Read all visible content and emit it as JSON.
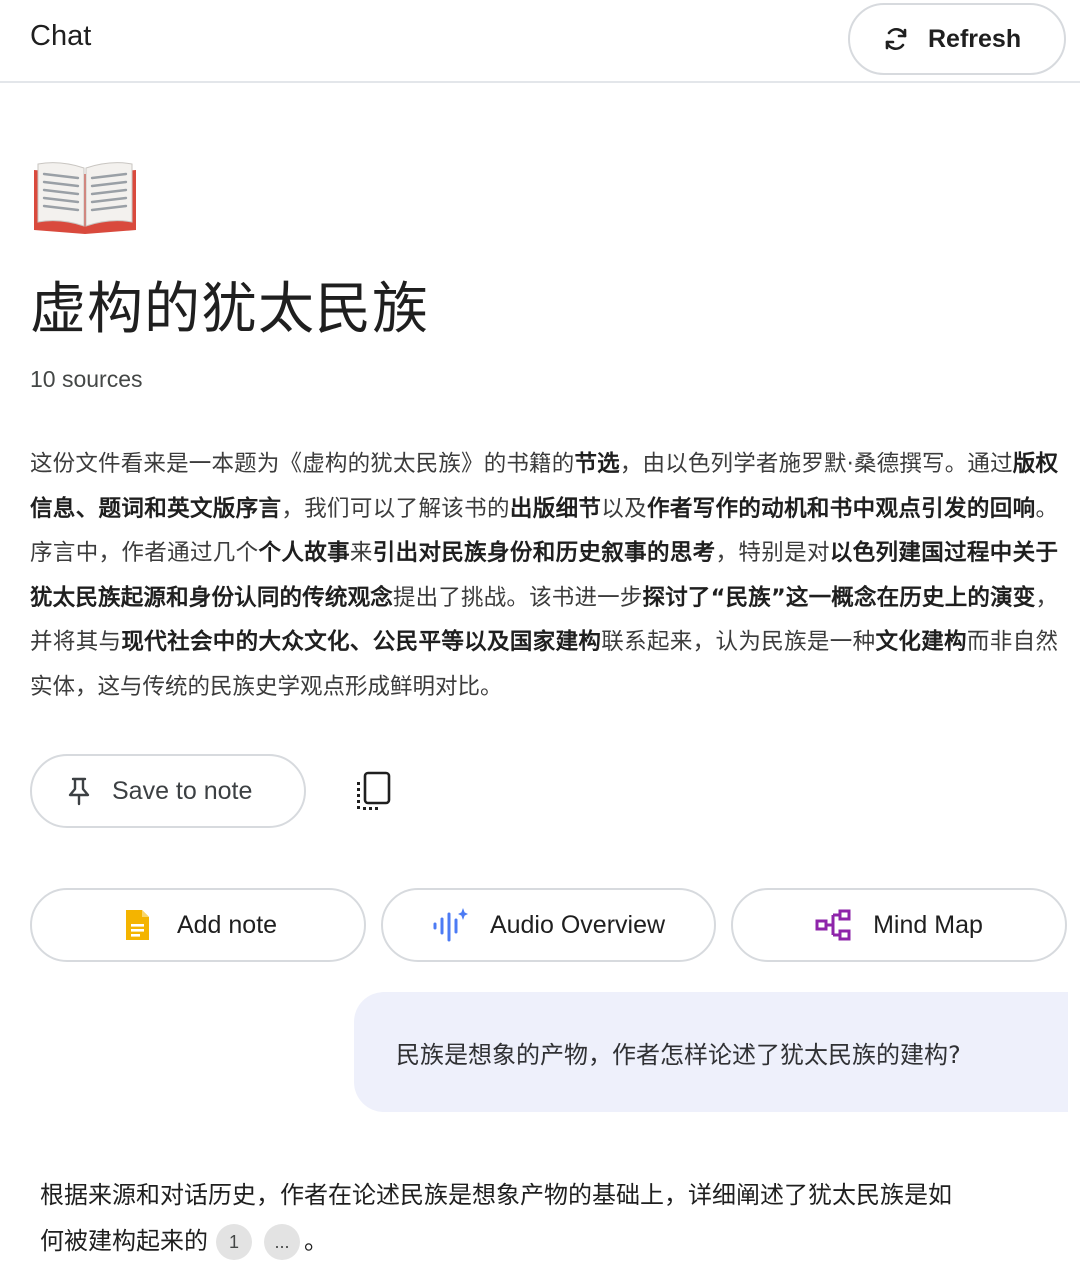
{
  "header": {
    "title": "Chat",
    "refresh_label": "Refresh"
  },
  "notebook": {
    "emoji_icon": "open-book-icon",
    "title": "虚构的犹太民族",
    "sources": "10 sources",
    "summary": [
      {
        "t": "这份文件看来是一本题为《虚构的犹太民族》的书籍的",
        "b": false
      },
      {
        "t": "节选",
        "b": true
      },
      {
        "t": "，由以色列学者施罗默·桑德撰写。通过",
        "b": false
      },
      {
        "t": "版权信息、题词和英文版序言",
        "b": true
      },
      {
        "t": "，我们可以了解该书的",
        "b": false
      },
      {
        "t": "出版细节",
        "b": true
      },
      {
        "t": "以及",
        "b": false
      },
      {
        "t": "作者写作的动机和书中观点引发的回响",
        "b": true
      },
      {
        "t": "。序言中，作者通过几个",
        "b": false
      },
      {
        "t": "个人故事",
        "b": true
      },
      {
        "t": "来",
        "b": false
      },
      {
        "t": "引出对民族身份和历史叙事的思考",
        "b": true
      },
      {
        "t": "，特别是对",
        "b": false
      },
      {
        "t": "以色列建国过程中关于犹太民族起源和身份认同的传统观念",
        "b": true
      },
      {
        "t": "提出了挑战。该书进一步",
        "b": false
      },
      {
        "t": "探讨了“民族”这一概念在历史上的演变",
        "b": true
      },
      {
        "t": "，并将其与",
        "b": false
      },
      {
        "t": "现代社会中的大众文化、公民平等以及国家建构",
        "b": true
      },
      {
        "t": "联系起来，认为民族是一种",
        "b": false
      },
      {
        "t": "文化建构",
        "b": true
      },
      {
        "t": "而非自然实体，这与传统的民族史学观点形成鲜明对比。",
        "b": false
      }
    ]
  },
  "actions": {
    "save_to_note": "Save to note",
    "add_note": "Add note",
    "audio_overview": "Audio Overview",
    "mind_map": "Mind Map"
  },
  "colors": {
    "note_icon": "#f4b400",
    "audio_icon": "#4c7bf4",
    "mindmap_icon": "#8e24aa",
    "user_bubble": "#eef0fb"
  },
  "conversation": {
    "user_message": "民族是想象的产物，作者怎样论述了犹太民族的建构?",
    "response_text": "根据来源和对话历史，作者在论述民族是想象产物的基础上，详细阐述了犹太民族是如何被建构起来的",
    "citation_1": "1",
    "citation_more": "...",
    "response_end": "。"
  }
}
